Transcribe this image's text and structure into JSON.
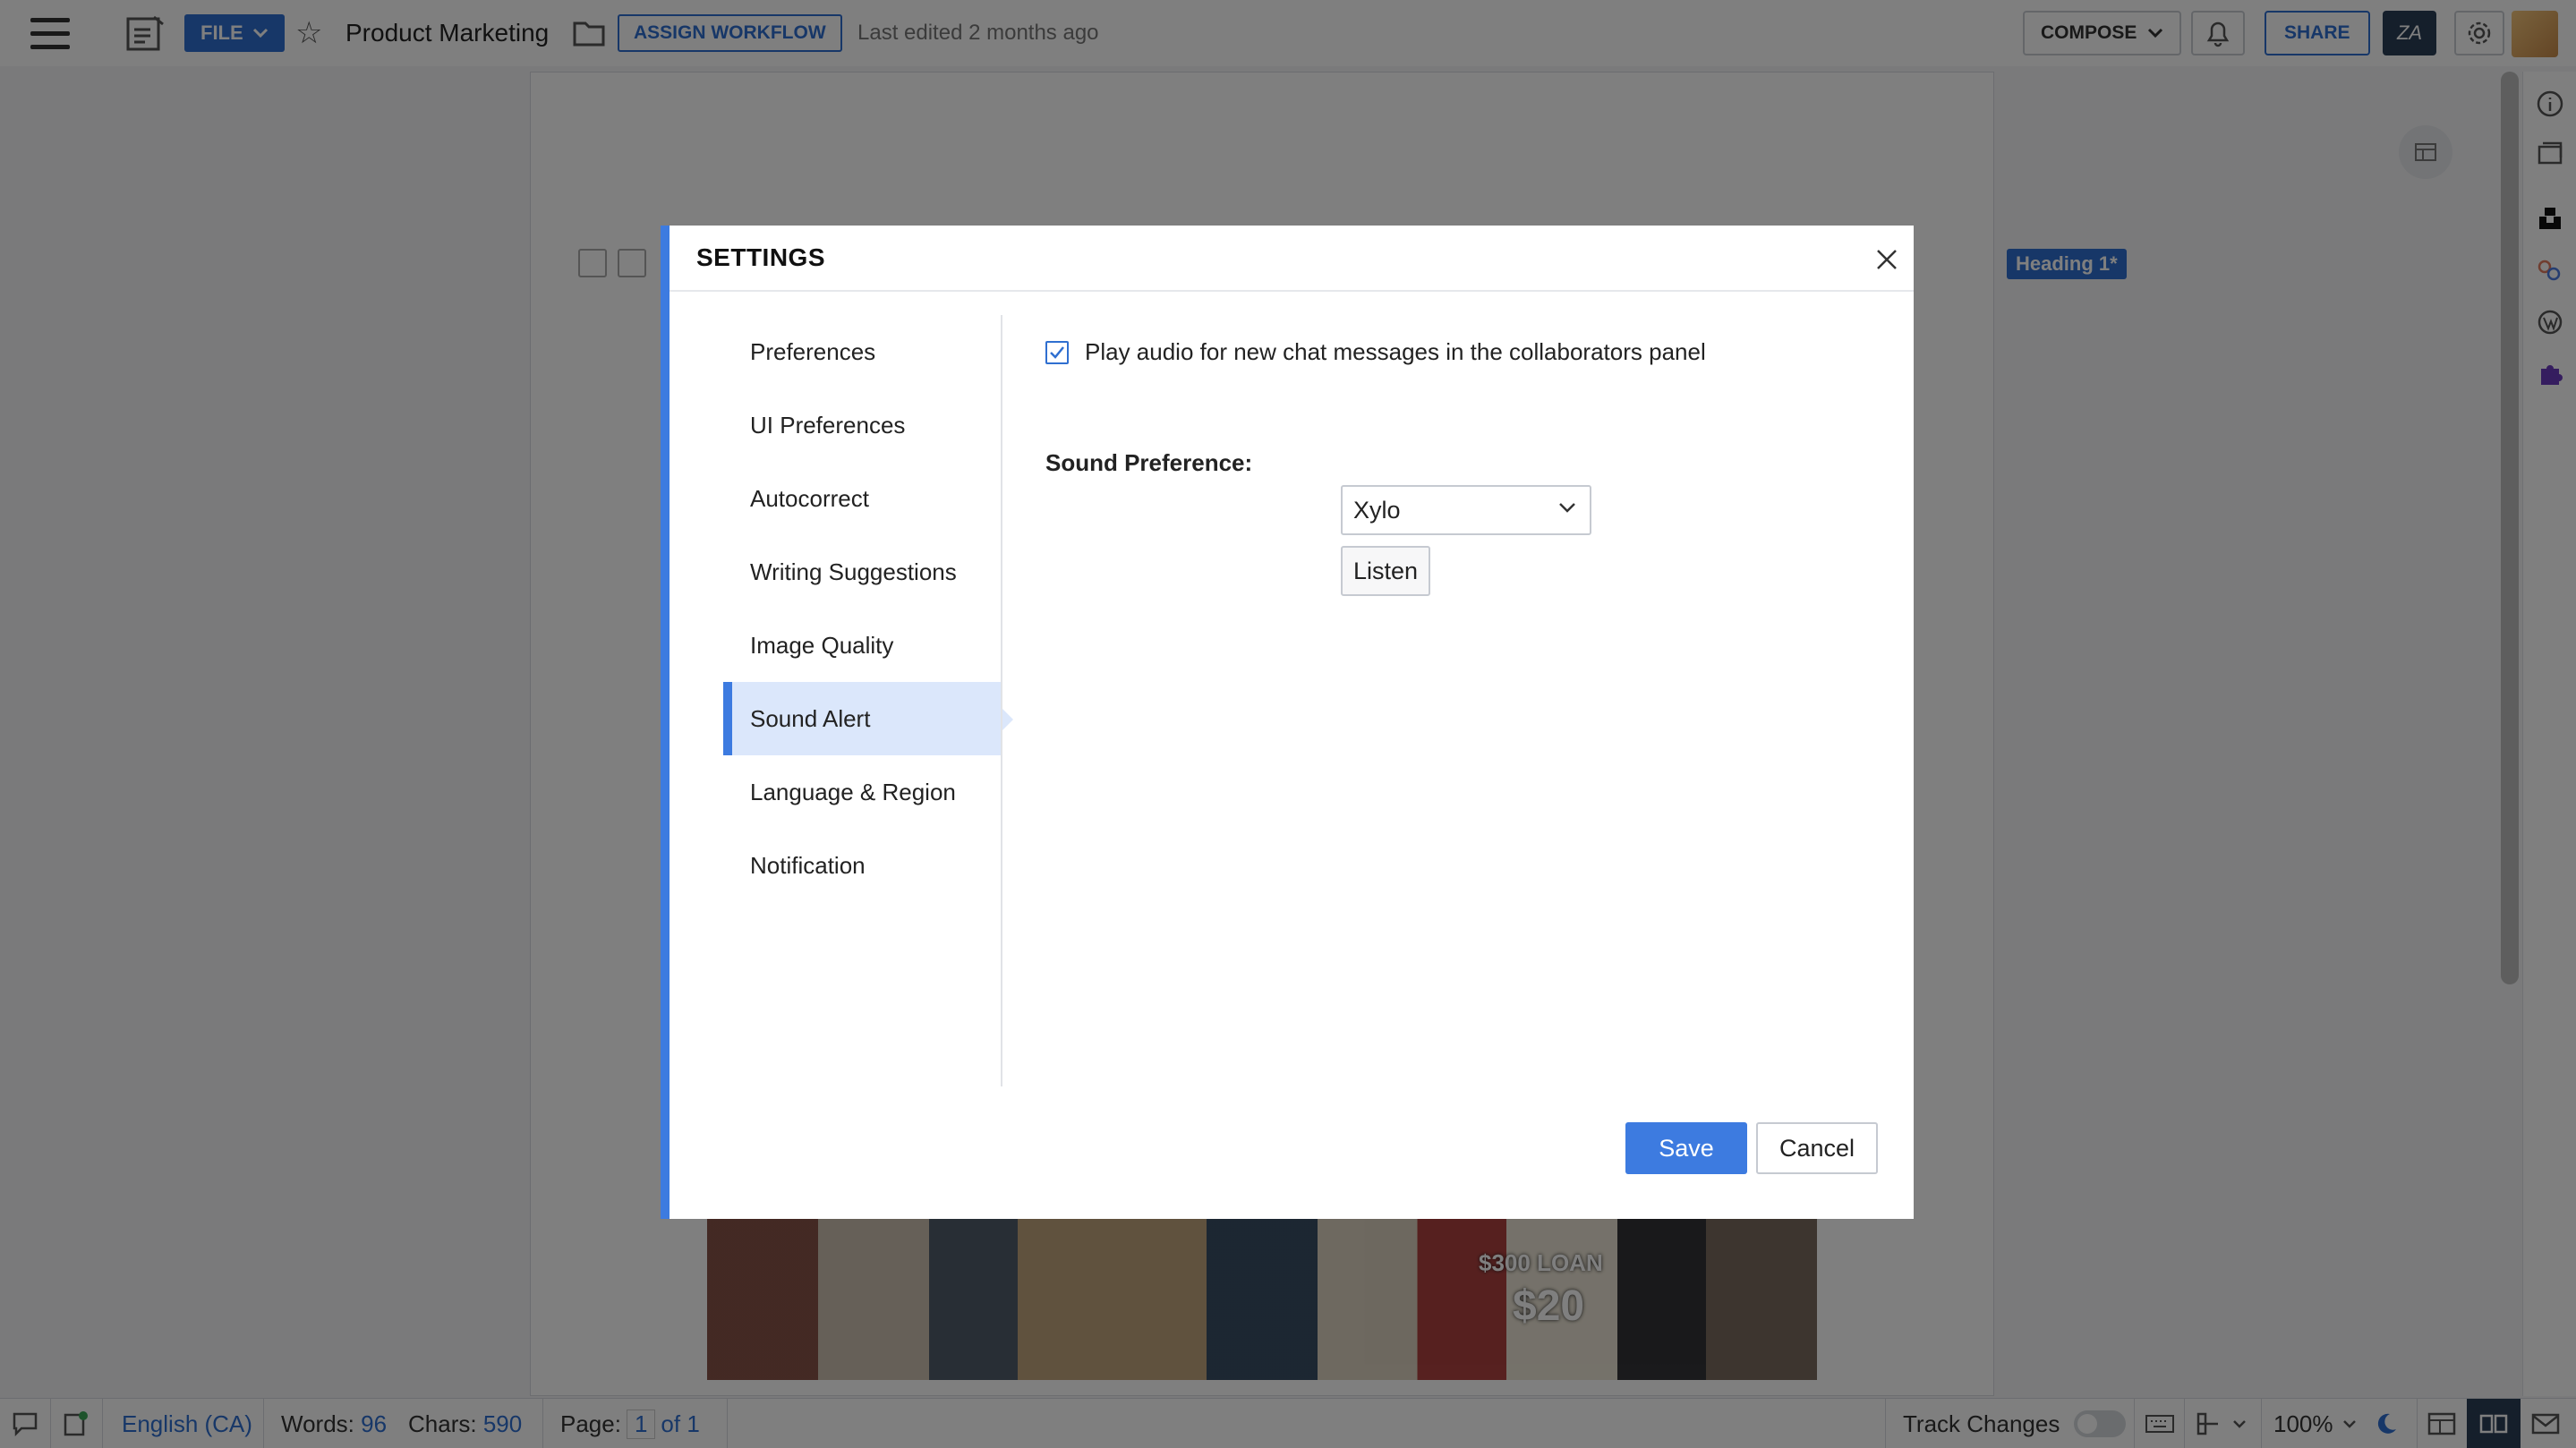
{
  "toolbar": {
    "file_label": "FILE",
    "doc_title": "Product Marketing",
    "assign_workflow_label": "ASSIGN WORKFLOW",
    "last_edited": "Last edited 2 months ago",
    "compose_label": "COMPOSE",
    "share_label": "SHARE",
    "za_label": "ZA"
  },
  "editor": {
    "heading_chip": "Heading 1*"
  },
  "photo_signs": {
    "sign_a": "$300 LOAN",
    "sign_b": "$20"
  },
  "statusbar": {
    "language": "English (CA)",
    "words_label": "Words:",
    "words_value": "96",
    "chars_label": "Chars:",
    "chars_value": "590",
    "page_label": "Page:",
    "page_current": "1",
    "page_total": "of 1",
    "track_changes": "Track Changes",
    "zoom": "100%"
  },
  "settings_dialog": {
    "title": "SETTINGS",
    "nav_items": [
      {
        "label": "Preferences"
      },
      {
        "label": "UI Preferences"
      },
      {
        "label": "Autocorrect"
      },
      {
        "label": "Writing Suggestions"
      },
      {
        "label": "Image Quality"
      },
      {
        "label": "Sound Alert",
        "active": true
      },
      {
        "label": "Language & Region"
      },
      {
        "label": "Notification"
      }
    ],
    "play_audio_label": "Play audio for new chat messages in the collaborators panel",
    "play_audio_checked": true,
    "sound_pref_label": "Sound Preference:",
    "sound_pref_value": "Xylo",
    "listen_label": "Listen",
    "save_label": "Save",
    "cancel_label": "Cancel"
  },
  "colors": {
    "accent": "#3d7be0",
    "active_nav_bg": "#dbe7fb",
    "topbar_dark_button": "#2b3e57"
  }
}
